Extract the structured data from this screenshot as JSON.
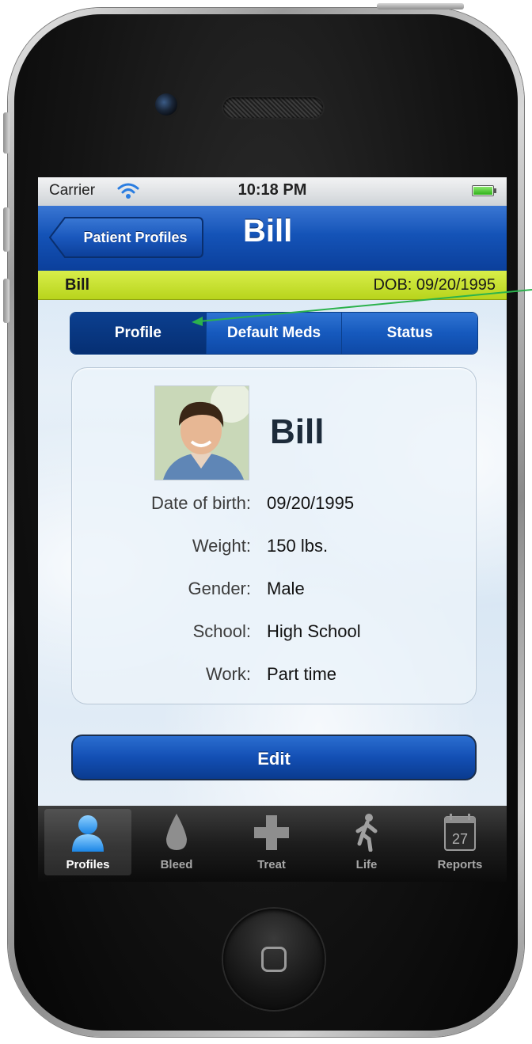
{
  "status_bar": {
    "carrier": "Carrier",
    "time": "10:18 PM"
  },
  "nav": {
    "back_label": "Patient Profiles",
    "title": "Bill"
  },
  "patient_bar": {
    "name": "Bill",
    "dob": "DOB: 09/20/1995"
  },
  "segments": [
    {
      "label": "Profile",
      "selected": true
    },
    {
      "label": "Default Meds",
      "selected": false
    },
    {
      "label": "Status",
      "selected": false
    }
  ],
  "profile": {
    "name": "Bill",
    "fields": [
      {
        "label": "Date of birth:",
        "value": "09/20/1995"
      },
      {
        "label": "Weight:",
        "value": "150 lbs."
      },
      {
        "label": "Gender:",
        "value": "Male"
      },
      {
        "label": "School:",
        "value": "High School"
      },
      {
        "label": "Work:",
        "value": "Part time"
      }
    ]
  },
  "edit_label": "Edit",
  "tabs": [
    {
      "label": "Profiles",
      "icon": "person-icon",
      "active": true
    },
    {
      "label": "Bleed",
      "icon": "drop-icon",
      "active": false
    },
    {
      "label": "Treat",
      "icon": "cross-icon",
      "active": false
    },
    {
      "label": "Life",
      "icon": "walking-person-icon",
      "active": false
    },
    {
      "label": "Reports",
      "icon": "calendar-icon",
      "active": false,
      "icon_text": "27"
    }
  ],
  "colors": {
    "nav_blue": "#1453b7",
    "patient_bar_green": "#c6e02a",
    "callout_green": "#2bb24c"
  }
}
